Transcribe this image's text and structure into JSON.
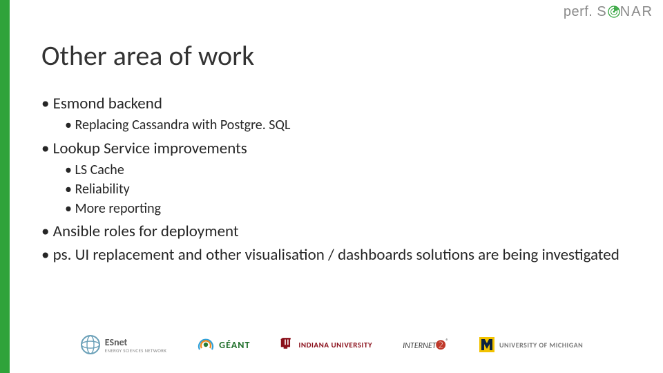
{
  "brand": {
    "left": "perf",
    "right": "S   NAR"
  },
  "title": "Other area of work",
  "bullets": {
    "b1": "Esmond backend",
    "b1_1": "Replacing Cassandra with Postgre. SQL",
    "b2": "Lookup Service improvements",
    "b2_1": "LS Cache",
    "b2_2": "Reliability",
    "b2_3": "More reporting",
    "b3": "Ansible roles for deployment",
    "b4": "ps. UI replacement and other visualisation / dashboards solutions are being investigated"
  },
  "footer": {
    "esnet": {
      "name": "ESnet",
      "sub": "ENERGY SCIENCES NETWORK"
    },
    "geant": {
      "name": "GÉANT"
    },
    "iu": {
      "name": "INDIANA UNIVERSITY"
    },
    "i2": {
      "name": "INTERNET"
    },
    "um": {
      "name": "UNIVERSITY OF MICHIGAN"
    }
  }
}
